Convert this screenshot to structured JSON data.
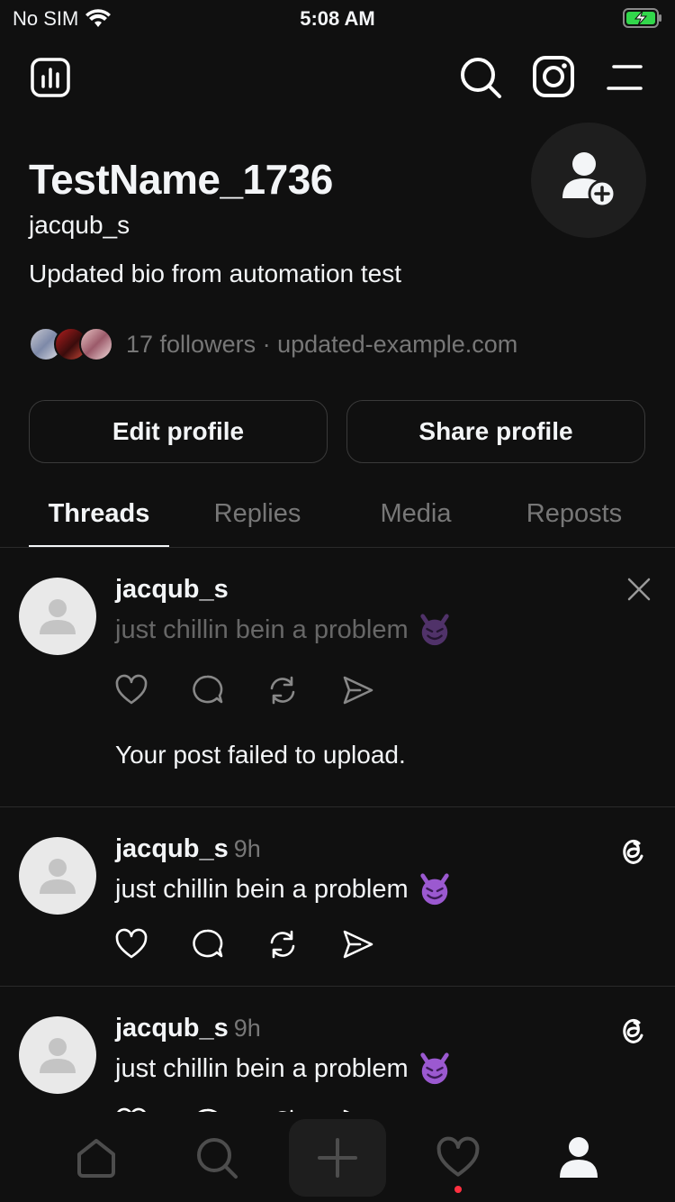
{
  "status": {
    "carrier": "No SIM",
    "time": "5:08 AM"
  },
  "profile": {
    "display_name": "TestName_1736",
    "handle": "jacqub_s",
    "bio": "Updated bio from automation test",
    "followers_text": "17 followers · updated-example.com"
  },
  "buttons": {
    "edit": "Edit profile",
    "share": "Share profile"
  },
  "tabs": [
    {
      "label": "Threads"
    },
    {
      "label": "Replies"
    },
    {
      "label": "Media"
    },
    {
      "label": "Reposts"
    }
  ],
  "posts": [
    {
      "user": "jacqub_s",
      "time": "",
      "text": "just chillin bein a problem",
      "status": "Your post failed to upload."
    },
    {
      "user": "jacqub_s",
      "time": "9h",
      "text": "just chillin bein a problem"
    },
    {
      "user": "jacqub_s",
      "time": "9h",
      "text": "just chillin bein a problem"
    }
  ],
  "colors": {
    "background": "#101010",
    "text": "#f3f5f7",
    "muted": "#777777",
    "border": "#3a3a3a",
    "notification": "#ff3040"
  },
  "icons": [
    "insights-icon",
    "search-icon",
    "instagram-icon",
    "menu-icon",
    "add-person-icon",
    "close-icon",
    "threads-logo-icon",
    "heart-icon",
    "comment-icon",
    "repost-icon",
    "share-icon",
    "home-icon",
    "plus-icon",
    "profile-icon"
  ]
}
